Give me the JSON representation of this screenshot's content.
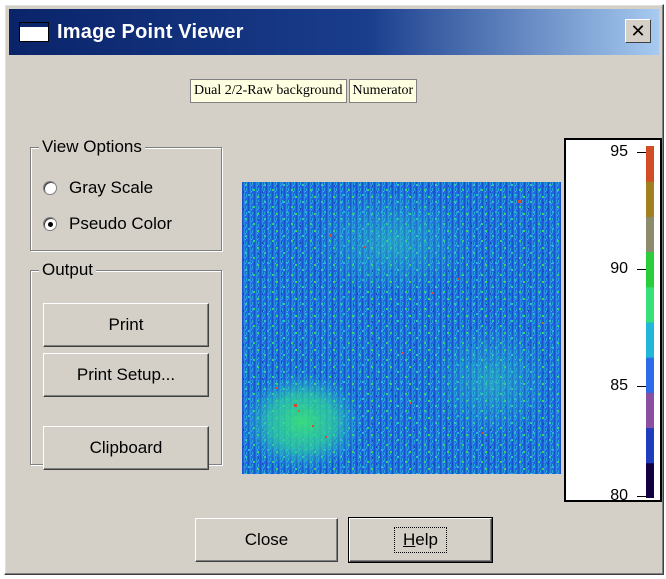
{
  "window": {
    "title": "Image Point Viewer",
    "close_glyph": "✕"
  },
  "labels": {
    "primary": "Dual 2/2-Raw background",
    "secondary": "Numerator"
  },
  "view_options": {
    "legend": "View Options",
    "gray_scale": "Gray Scale",
    "pseudo_color": "Pseudo Color",
    "selected": "Pseudo Color"
  },
  "output": {
    "legend": "Output",
    "print": "Print",
    "print_setup": "Print Setup...",
    "clipboard": "Clipboard"
  },
  "buttons": {
    "close": "Close",
    "help": "Help"
  },
  "color_scale": {
    "ticks": [
      "95",
      "90",
      "85",
      "80"
    ],
    "min": 80,
    "max": 95,
    "colors_bottom_to_top": [
      "#100040",
      "#1e3cbc",
      "#8a4fa0",
      "#2f6ae8",
      "#23b6d8",
      "#39e07a",
      "#2ccd3c",
      "#8c8c6c",
      "#a08020",
      "#d24c26"
    ]
  },
  "colors": {
    "dialog_bg": "#d4d0c8",
    "title_bar": "#0a246a",
    "label_bg": "#ffffe1"
  }
}
